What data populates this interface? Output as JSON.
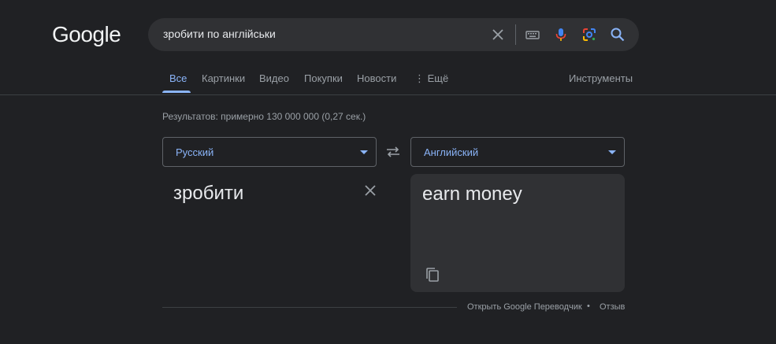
{
  "logo": "Google",
  "search": {
    "query": "зробити по англійськи"
  },
  "tabs": [
    {
      "label": "Все",
      "active": true
    },
    {
      "label": "Картинки",
      "active": false
    },
    {
      "label": "Видео",
      "active": false
    },
    {
      "label": "Покупки",
      "active": false
    },
    {
      "label": "Новости",
      "active": false
    },
    {
      "label": "⋮ Ещё",
      "active": false
    }
  ],
  "tools_label": "Инструменты",
  "results_stats": "Результатов: примерно 130 000 000 (0,27 сек.)",
  "translator": {
    "source_lang": "Русский",
    "target_lang": "Английский",
    "source_text": "зробити",
    "target_text": "earn money",
    "open_link": "Открыть Google Переводчик",
    "separator": "•",
    "feedback": "Отзыв"
  },
  "colors": {
    "background": "#202124",
    "accent": "#8ab4f8",
    "panel": "#303134"
  },
  "icons": [
    "clear-icon",
    "keyboard-icon",
    "microphone-icon",
    "lens-icon",
    "search-icon",
    "swap-icon",
    "close-icon",
    "copy-icon",
    "caret-down-icon"
  ]
}
